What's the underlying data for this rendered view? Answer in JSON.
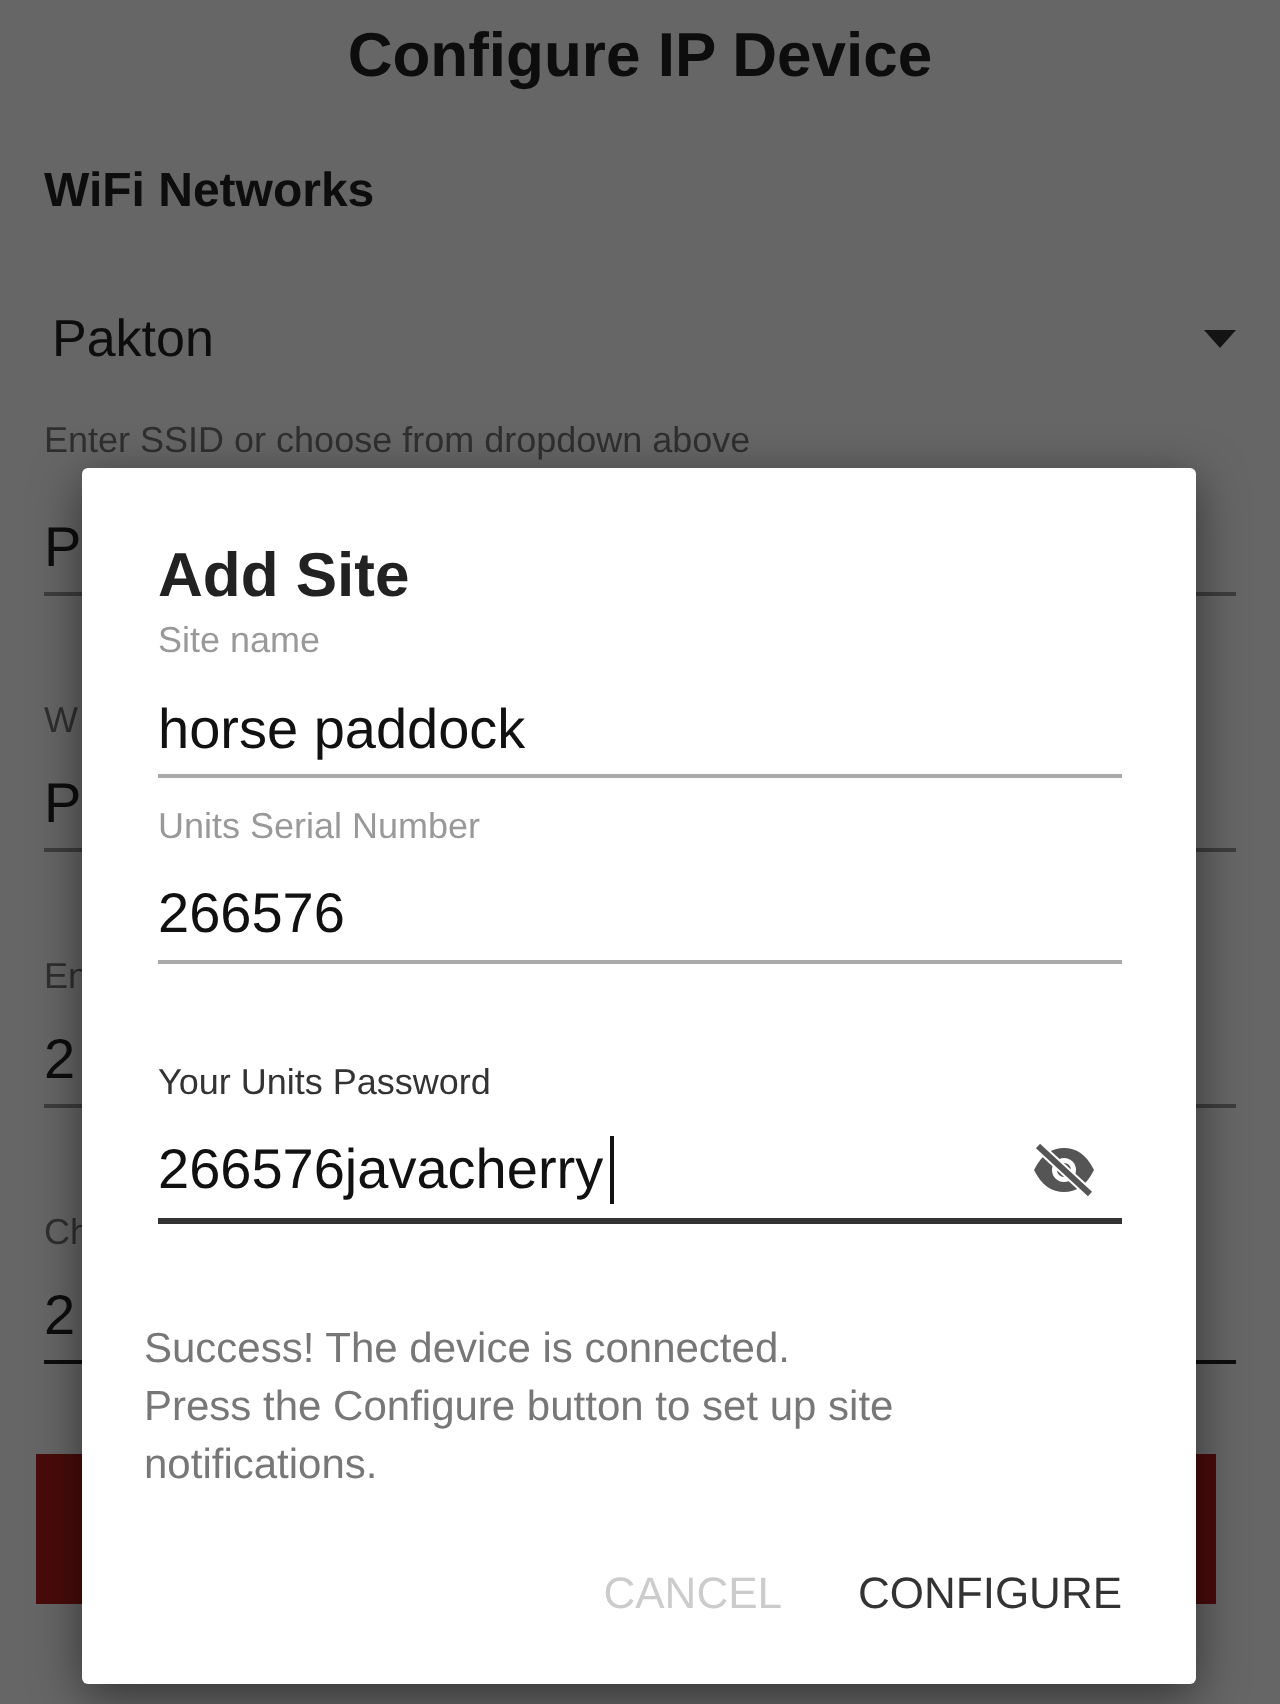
{
  "background": {
    "title": "Configure IP Device",
    "section": "WiFi Networks",
    "dropdown": {
      "value": "Pakton"
    },
    "fields": [
      {
        "label": "Enter SSID or choose from dropdown above",
        "value": "P",
        "focused": false
      },
      {
        "label": "W",
        "value": "P",
        "focused": false
      },
      {
        "label": "En",
        "value": "2",
        "focused": false
      },
      {
        "label": "Ch",
        "value": "2",
        "focused": true
      }
    ]
  },
  "dialog": {
    "title": "Add Site",
    "fields": [
      {
        "kind": "text",
        "label": "Site name",
        "value": "horse paddock",
        "focused": false
      },
      {
        "kind": "text",
        "label": "Units Serial Number",
        "value": "266576",
        "focused": false
      },
      {
        "kind": "password",
        "label": "Your Units Password",
        "value": "266576javacherry",
        "focused": true,
        "visible": true
      }
    ],
    "message": "Success! The device is connected.\nPress the Configure button to set up site notifications.",
    "buttons": [
      {
        "label": "CANCEL",
        "disabled": true
      },
      {
        "label": "CONFIGURE",
        "disabled": false
      }
    ]
  }
}
